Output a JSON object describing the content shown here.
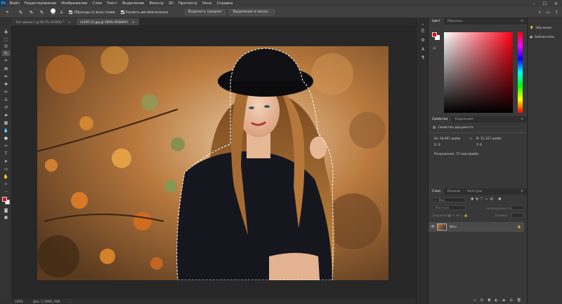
{
  "app": {
    "logo": "Ps"
  },
  "menu": [
    "Файл",
    "Редактирование",
    "Изображение",
    "Слои",
    "Текст",
    "Выделение",
    "Фильтр",
    "3D",
    "Просмотр",
    "Окно",
    "Справка"
  ],
  "options": {
    "size": "30",
    "sample_all_layers": "Образцы со всех слоев",
    "auto_enhance": "Усилить автоматически",
    "select_subject": "Выделить предмет",
    "select_and_mask": "Выделение и маска..."
  },
  "tabs": [
    {
      "label": "Без имени-1 @ 66,7% (RGB/8) *",
      "active": false
    },
    {
      "label": "с1200 (1).jpg @ 100% (RGB/8#)",
      "active": true
    }
  ],
  "status": {
    "zoom": "100%",
    "doc": "Док: 1,76M/1,76M"
  },
  "color_panel": {
    "tab_color": "Цвет",
    "tab_swatches": "Образцы",
    "fg_color": "#e3001b",
    "bg_color": "#ffffff"
  },
  "properties_panel": {
    "tab_properties": "Свойства",
    "tab_corrections": "Коррекция",
    "doc_props": "Свойства документа",
    "width": "Ш: 16,087 дюйм",
    "height": "В: 11,107 дюйм",
    "x": "X: 0",
    "y": "Y: 0",
    "resolution": "Разрешение: 72 пикс/дюйм"
  },
  "layers_panel": {
    "tab_layers": "Слои",
    "tab_channels": "Каналы",
    "tab_paths": "Контуры",
    "kind": "Вид",
    "blend_mode": "Обычные",
    "opacity_label": "Непрозрачность:",
    "lock_label": "Закрепить:",
    "fill_label": "Заливка:",
    "layer_name": "Фон"
  },
  "learn_panel": {
    "learn": "Обучение",
    "libraries": "Библиотеки"
  },
  "icons": [
    "move-icon",
    "marquee-icon",
    "lasso-icon",
    "quick-select-icon",
    "crop-icon",
    "eyedropper-icon",
    "heal-icon",
    "brush-icon",
    "stamp-icon",
    "history-brush-icon",
    "eraser-icon",
    "gradient-icon",
    "blur-icon",
    "dodge-icon",
    "pen-icon",
    "type-icon",
    "path-select-icon",
    "shape-icon",
    "hand-icon",
    "zoom-icon"
  ]
}
